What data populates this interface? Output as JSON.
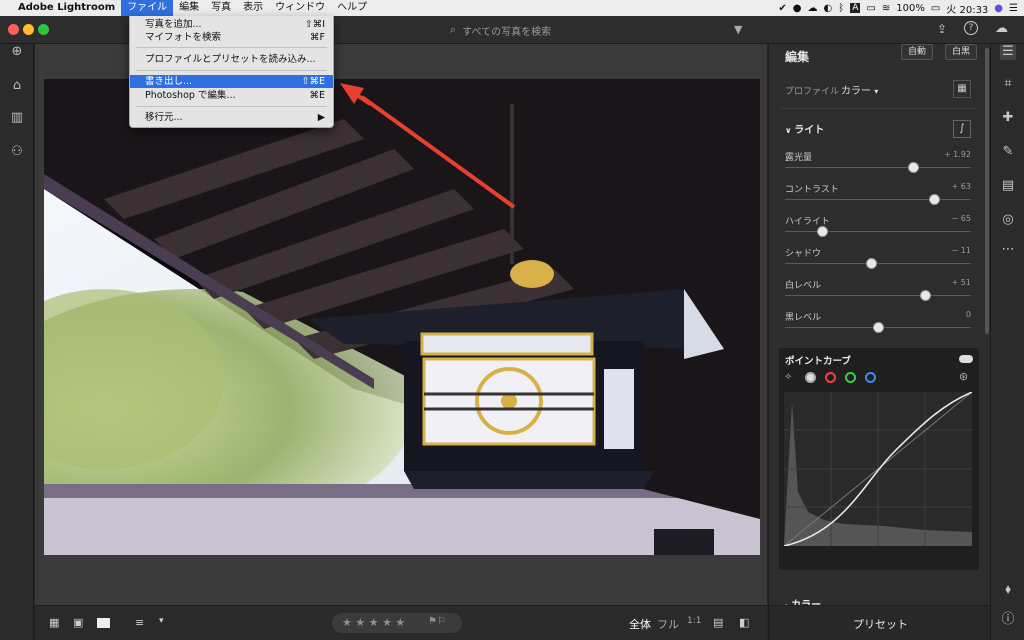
{
  "menubar": {
    "apple": "",
    "app_name": "Adobe Lightroom",
    "items": [
      "ファイル",
      "編集",
      "写真",
      "表示",
      "ウィンドウ",
      "ヘルプ"
    ],
    "battery": "100%",
    "clock": "火 20:33"
  },
  "file_menu": {
    "items": [
      {
        "label": "写真を追加...",
        "shortcut": "⇧⌘I"
      },
      {
        "label": "マイフォトを検索",
        "shortcut": "⌘F"
      },
      {
        "label": "プロファイルとプリセットを読み込み...",
        "shortcut": ""
      },
      {
        "label": "書き出し...",
        "shortcut": "⇧⌘E",
        "highlighted": true
      },
      {
        "label": "Photoshop で編集...",
        "shortcut": "⌘E"
      },
      {
        "label": "移行元...",
        "shortcut": "▶"
      }
    ]
  },
  "search": {
    "placeholder": "すべての写真を検索"
  },
  "edit_panel": {
    "title": "編集",
    "auto_label": "自動",
    "bw_label": "白黒",
    "profile_label": "プロファイル",
    "profile_value": "カラー",
    "light_section": "ライト",
    "sliders": [
      {
        "label": "露光量",
        "value": "+ 1.92",
        "level": 0.69
      },
      {
        "label": "コントラスト",
        "value": "+ 63",
        "level": 0.8
      },
      {
        "label": "ハイライト",
        "value": "− 65",
        "level": 0.2
      },
      {
        "label": "シャドウ",
        "value": "− 11",
        "level": 0.46
      },
      {
        "label": "白レベル",
        "value": "+ 51",
        "level": 0.75
      },
      {
        "label": "黒レベル",
        "value": "0",
        "level": 0.5
      }
    ],
    "curve_title": "ポイントカーブ",
    "color_section": "カラー",
    "presets_label": "プリセット"
  },
  "bottombar": {
    "view_all": "全体",
    "view_fit": "フル",
    "view_1to1": "1:1",
    "stars": "★ ★ ★ ★ ★"
  },
  "colors": {
    "accent": "#2f6fe0",
    "arrow": "#e8402f",
    "panel": "#2d2d2d",
    "canvas": "#3a3a3a"
  }
}
